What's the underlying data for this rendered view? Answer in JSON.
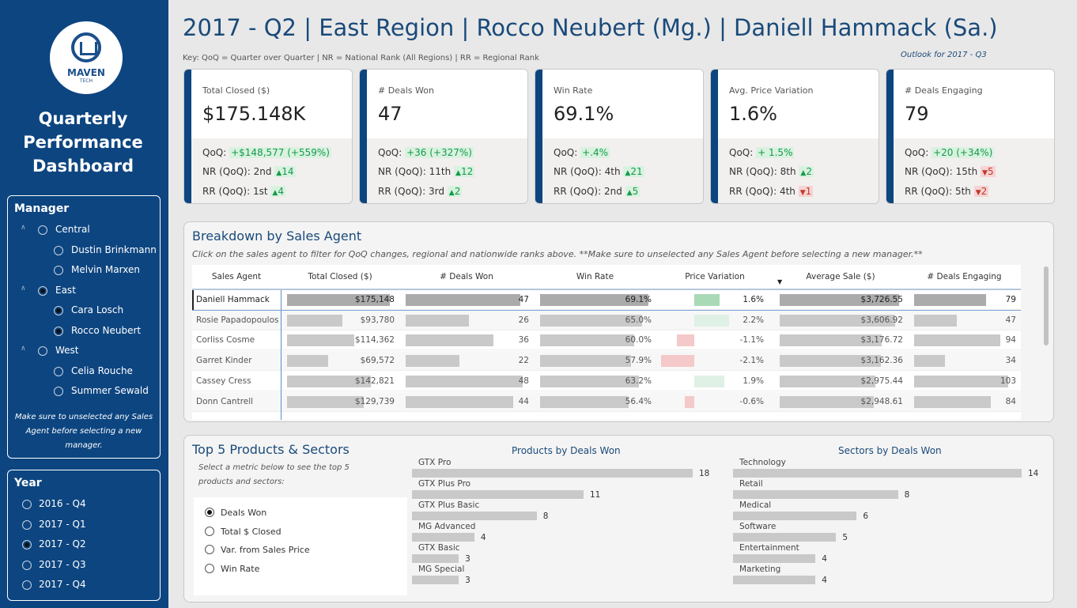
{
  "sidebar": {
    "logo_name": "MAVEN",
    "logo_sub": "TECH",
    "title": "Quarterly\nPerformance\nDashboard",
    "manager_label": "Manager",
    "manager_tree": [
      {
        "label": "Central",
        "level": 0,
        "selected": false
      },
      {
        "label": "Dustin Brinkmann",
        "level": 1,
        "selected": false
      },
      {
        "label": "Melvin Marxen",
        "level": 1,
        "selected": false
      },
      {
        "label": "East",
        "level": 0,
        "selected": true
      },
      {
        "label": "Cara Losch",
        "level": 1,
        "selected": true
      },
      {
        "label": "Rocco Neubert",
        "level": 1,
        "selected": true
      },
      {
        "label": "West",
        "level": 0,
        "selected": false
      },
      {
        "label": "Celia Rouche",
        "level": 1,
        "selected": false
      },
      {
        "label": "Summer Sewald",
        "level": 1,
        "selected": false
      }
    ],
    "manager_note": "Make sure to unselected any Sales Agent before selecting a new manager.",
    "year_label": "Year",
    "years": [
      {
        "label": "2016 - Q4",
        "selected": false
      },
      {
        "label": "2017 - Q1",
        "selected": false
      },
      {
        "label": "2017 - Q2",
        "selected": true
      },
      {
        "label": "2017 - Q3",
        "selected": false
      },
      {
        "label": "2017 - Q4",
        "selected": false
      }
    ]
  },
  "header": {
    "title": "2017 - Q2 | East Region | Rocco Neubert (Mg.) | Daniell Hammack (Sa.)",
    "key": "Key: QoQ = Quarter over Quarter | NR = National Rank (All Regions) | RR = Regional Rank",
    "outlook": "Outlook for 2017 - Q3"
  },
  "kpis": [
    {
      "title": "Total Closed ($)",
      "value": "$175.148K",
      "qoq": "+$148,577 (+559%)",
      "nr_rank": "2nd",
      "nr_delta": "14",
      "nr_dir": "up",
      "rr_rank": "1st",
      "rr_delta": "4",
      "rr_dir": "up"
    },
    {
      "title": "# Deals Won",
      "value": "47",
      "qoq": "+36 (+327%)",
      "nr_rank": "11th",
      "nr_delta": "12",
      "nr_dir": "up",
      "rr_rank": "3rd",
      "rr_delta": "2",
      "rr_dir": "up"
    },
    {
      "title": "Win Rate",
      "value": "69.1%",
      "qoq": "+.4%",
      "nr_rank": "4th",
      "nr_delta": "21",
      "nr_dir": "up",
      "rr_rank": "2nd",
      "rr_delta": "5",
      "rr_dir": "up"
    },
    {
      "title": "Avg. Price Variation",
      "value": "1.6%",
      "qoq": "+ 1.5%",
      "nr_rank": "8th",
      "nr_delta": "2",
      "nr_dir": "up",
      "rr_rank": "4th",
      "rr_delta": "1",
      "rr_dir": "down"
    },
    {
      "title": "# Deals Engaging",
      "value": "79",
      "qoq": "+20 (+34%)",
      "nr_rank": "15th",
      "nr_delta": "5",
      "nr_dir": "down",
      "rr_rank": "5th",
      "rr_delta": "2",
      "rr_dir": "down"
    }
  ],
  "kpi_labels": {
    "qoq": "QoQ:",
    "nr": "NR (QoQ):",
    "rr": "RR (QoQ):"
  },
  "agents_panel": {
    "title": "Breakdown by Sales Agent",
    "subtitle": "Click on the sales agent to filter for QoQ changes, regional and nationwide ranks above. **Make sure to unselected any Sales Agent before selecting a new manager.**",
    "columns": [
      "Sales Agent",
      "Total Closed ($)",
      "# Deals Won",
      "Win Rate",
      "Price Variation",
      "Average Sale ($)",
      "# Deals Engaging"
    ],
    "rows": [
      {
        "agent": "Daniell Hammack",
        "total": "$175,148",
        "total_v": 175148,
        "won": "47",
        "won_v": 47,
        "rate": "69.1%",
        "rate_v": 69.1,
        "pvar": "1.6%",
        "pvar_v": 1.6,
        "avg": "$3,726.55",
        "avg_v": 3726.55,
        "eng": "79",
        "eng_v": 79,
        "selected": true
      },
      {
        "agent": "Rosie Papadopoulos",
        "total": "$93,780",
        "total_v": 93780,
        "won": "26",
        "won_v": 26,
        "rate": "65.0%",
        "rate_v": 65.0,
        "pvar": "2.2%",
        "pvar_v": 2.2,
        "avg": "$3,606.92",
        "avg_v": 3606.92,
        "eng": "47",
        "eng_v": 47,
        "selected": false
      },
      {
        "agent": "Corliss Cosme",
        "total": "$114,362",
        "total_v": 114362,
        "won": "36",
        "won_v": 36,
        "rate": "60.0%",
        "rate_v": 60.0,
        "pvar": "-1.1%",
        "pvar_v": -1.1,
        "avg": "$3,176.72",
        "avg_v": 3176.72,
        "eng": "94",
        "eng_v": 94,
        "selected": false
      },
      {
        "agent": "Garret Kinder",
        "total": "$69,572",
        "total_v": 69572,
        "won": "22",
        "won_v": 22,
        "rate": "57.9%",
        "rate_v": 57.9,
        "pvar": "-2.1%",
        "pvar_v": -2.1,
        "avg": "$3,162.36",
        "avg_v": 3162.36,
        "eng": "34",
        "eng_v": 34,
        "selected": false
      },
      {
        "agent": "Cassey Cress",
        "total": "$142,821",
        "total_v": 142821,
        "won": "48",
        "won_v": 48,
        "rate": "63.2%",
        "rate_v": 63.2,
        "pvar": "1.9%",
        "pvar_v": 1.9,
        "avg": "$2,975.44",
        "avg_v": 2975.44,
        "eng": "103",
        "eng_v": 103,
        "selected": false
      },
      {
        "agent": "Donn Cantrell",
        "total": "$129,739",
        "total_v": 129739,
        "won": "44",
        "won_v": 44,
        "rate": "56.4%",
        "rate_v": 56.4,
        "pvar": "-0.6%",
        "pvar_v": -0.6,
        "avg": "$2,948.61",
        "avg_v": 2948.61,
        "eng": "84",
        "eng_v": 84,
        "selected": false
      }
    ]
  },
  "products_panel": {
    "title": "Top 5 Products & Sectors",
    "subtitle": "Select a metric below to see the top 5\nproducts and sectors:",
    "metrics": [
      {
        "label": "Deals Won",
        "selected": true
      },
      {
        "label": "Total $ Closed",
        "selected": false
      },
      {
        "label": "Var. from Sales Price",
        "selected": false
      },
      {
        "label": "Win Rate",
        "selected": false
      }
    ]
  },
  "chart_data": [
    {
      "type": "bar",
      "orientation": "horizontal",
      "title": "Products by Deals Won",
      "categories": [
        "GTX Pro",
        "GTX Plus Pro",
        "GTX Plus Basic",
        "MG Advanced",
        "GTX Basic",
        "MG Special"
      ],
      "values": [
        18,
        11,
        8,
        4,
        3,
        3
      ]
    },
    {
      "type": "bar",
      "orientation": "horizontal",
      "title": "Sectors by Deals Won",
      "categories": [
        "Technology",
        "Retail",
        "Medical",
        "Software",
        "Entertainment",
        "Marketing"
      ],
      "values": [
        14,
        8,
        6,
        5,
        4,
        4
      ]
    }
  ]
}
